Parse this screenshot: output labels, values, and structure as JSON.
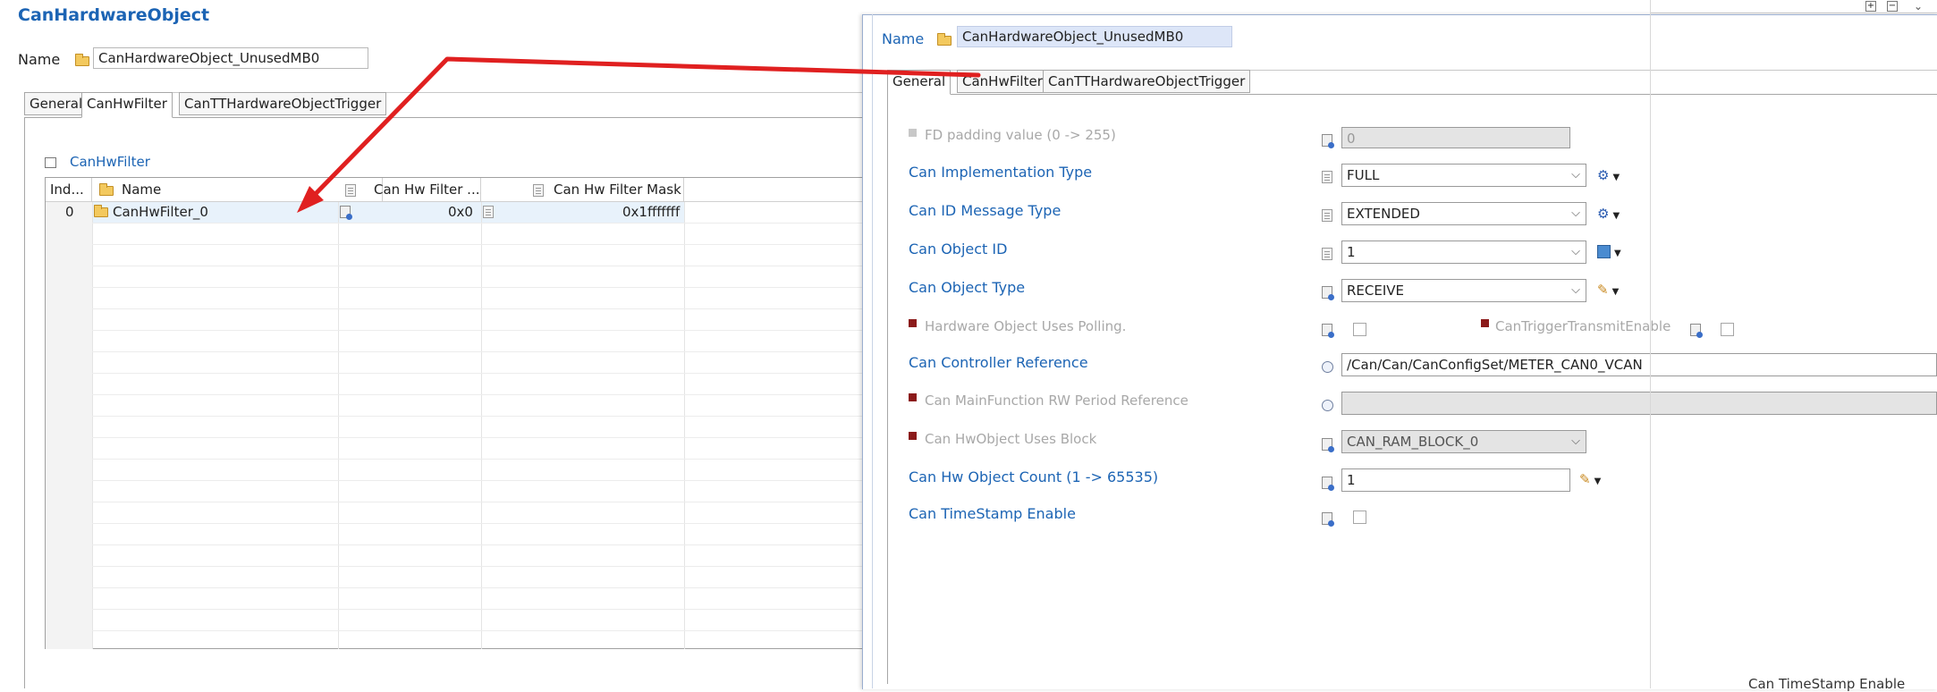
{
  "left": {
    "title": "CanHardwareObject",
    "name_label": "Name",
    "name_value": "CanHardwareObject_UnusedMB0",
    "tabs": [
      "General",
      "CanHwFilter",
      "CanTTHardwareObjectTrigger"
    ],
    "section_title": "CanHwFilter",
    "table": {
      "headers": [
        "Ind...",
        "Name",
        "Can Hw Filter ...",
        "Can Hw Filter Mask"
      ],
      "rows": [
        {
          "index": "0",
          "name": "CanHwFilter_0",
          "code": "0x0",
          "mask": "0x1fffffff"
        }
      ]
    }
  },
  "right": {
    "name_label": "Name",
    "name_value": "CanHardwareObject_UnusedMB0",
    "tabs": [
      "General",
      "CanHwFilter",
      "CanTTHardwareObjectTrigger"
    ],
    "fields": {
      "fd_padding": {
        "label": "FD padding value (0 -> 255)",
        "value": "0"
      },
      "impl_type": {
        "label": "Can Implementation Type",
        "value": "FULL"
      },
      "id_msg_type": {
        "label": "Can ID Message Type",
        "value": "EXTENDED"
      },
      "object_id": {
        "label": "Can Object ID",
        "value": "1"
      },
      "object_type": {
        "label": "Can Object Type",
        "value": "RECEIVE"
      },
      "polling": {
        "label": "Hardware Object Uses Polling."
      },
      "trigger_tx": {
        "label": "CanTriggerTransmitEnable"
      },
      "ctrl_ref": {
        "label": "Can Controller Reference",
        "value": "/Can/Can/CanConfigSet/METER_CAN0_VCAN"
      },
      "mainfunc_ref": {
        "label": "Can MainFunction RW Period Reference",
        "value": ""
      },
      "uses_block": {
        "label": "Can HwObject Uses Block",
        "value": "CAN_RAM_BLOCK_0"
      },
      "obj_count": {
        "label": "Can Hw Object Count (1 -> 65535)",
        "value": "1"
      },
      "timestamp": {
        "label": "Can TimeStamp Enable"
      }
    }
  },
  "background_snippet": "Can TimeStamp Enable"
}
